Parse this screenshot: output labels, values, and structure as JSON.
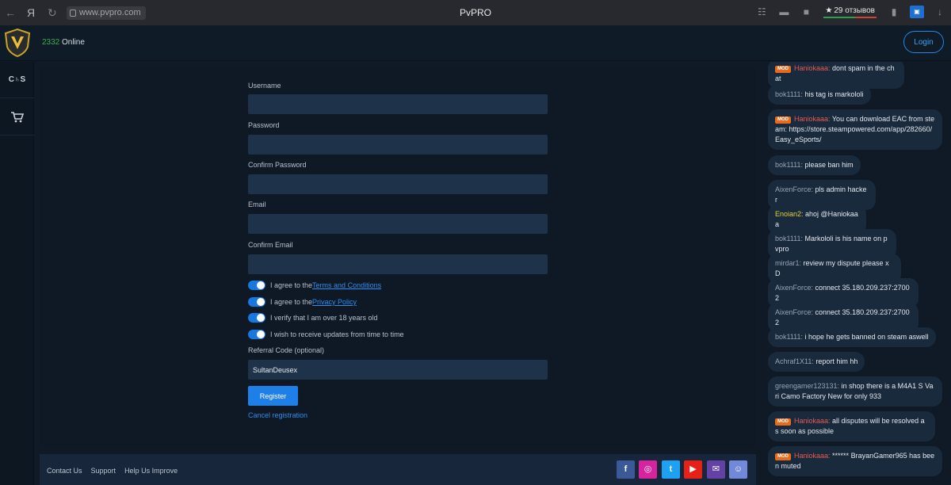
{
  "browser": {
    "back_icon": "←",
    "home_icon": "Я",
    "reload_icon": "↻",
    "url": "www.pvpro.com",
    "title": "PvPRO",
    "reviews_label": "29 отзывов",
    "star": "★"
  },
  "header": {
    "online_count": "2332",
    "online_label": " Online",
    "login_label": "Login"
  },
  "sidebar": {
    "items": [
      {
        "icon": "counter-strike-icon",
        "glyph": "C♄S"
      },
      {
        "icon": "cart-icon",
        "glyph": "🛒"
      }
    ]
  },
  "form": {
    "username_label": "Username",
    "password_label": "Password",
    "confirm_password_label": "Confirm Password",
    "email_label": "Email",
    "confirm_email_label": "Confirm Email",
    "terms_prefix": "I agree to the",
    "terms_link": "Terms and Conditions",
    "privacy_prefix": "I agree to the",
    "privacy_link": "Privacy Policy",
    "age_label": "I verify that I am over 18 years old",
    "updates_label": "I wish to receive updates from time to time",
    "referral_label": "Referral Code (optional)",
    "referral_value": "SultanDeusex",
    "register_label": "Register",
    "cancel_label": "Cancel registration"
  },
  "footer": {
    "contact": "Contact Us",
    "support": "Support",
    "help": "Help Us Improve",
    "socials": [
      {
        "name": "facebook-icon",
        "glyph": "f",
        "color": "#3b5998"
      },
      {
        "name": "instagram-icon",
        "glyph": "◎",
        "color": "#d6249f"
      },
      {
        "name": "twitter-icon",
        "glyph": "t",
        "color": "#1da1f2"
      },
      {
        "name": "youtube-icon",
        "glyph": "▶",
        "color": "#e62117"
      },
      {
        "name": "twitch-icon",
        "glyph": "✉",
        "color": "#6441a4"
      },
      {
        "name": "discord-icon",
        "glyph": "☺",
        "color": "#7289da"
      }
    ]
  },
  "chat": {
    "mod_badge": "MOD",
    "messages": [
      {
        "user": "Haniokaaa",
        "role": "mod",
        "text": "dont spam in the chat"
      },
      {
        "user": "bok1111",
        "role": "user",
        "text": "his tag is markololi"
      },
      {
        "user": "Haniokaaa",
        "role": "mod",
        "text": "You can download EAC from steam: https://store.steampowered.com/app/282660/Easy_eSports/"
      },
      {
        "user": "bok1111",
        "role": "user",
        "text": "please ban him"
      },
      {
        "user": "AixenForce",
        "role": "user",
        "text": "pls admin hacker"
      },
      {
        "user": "Enoian2",
        "role": "yellow",
        "text": "ahoj @Haniokaaa"
      },
      {
        "user": "bok1111",
        "role": "user",
        "text": "Markololi is his name on pvpro"
      },
      {
        "user": "mirdar1",
        "role": "user",
        "text": "review my dispute please xD"
      },
      {
        "user": "AixenForce",
        "role": "user",
        "text": "connect 35.180.209.237:27002"
      },
      {
        "user": "AixenForce",
        "role": "user",
        "text": "connect 35.180.209.237:27002"
      },
      {
        "user": "bok1111",
        "role": "user",
        "text": "i hope he gets banned on steam aswell"
      },
      {
        "user": "Achraf1X11",
        "role": "user",
        "text": "report him hh"
      },
      {
        "user": "greengamer123131",
        "role": "user",
        "text": "in shop there is a M4A1 S Vari Camo Factory New for only 933"
      },
      {
        "user": "Haniokaaa",
        "role": "mod",
        "text": "all disputes will be resolved as soon as possible"
      },
      {
        "user": "Haniokaaa",
        "role": "mod",
        "text": "****** BrayanGamer965 has been muted"
      }
    ]
  },
  "colors": {
    "accent": "#1f7fe8",
    "online_green": "#3ab04c",
    "mod_red": "#e85a50",
    "mod_badge_orange": "#e86a1c"
  }
}
